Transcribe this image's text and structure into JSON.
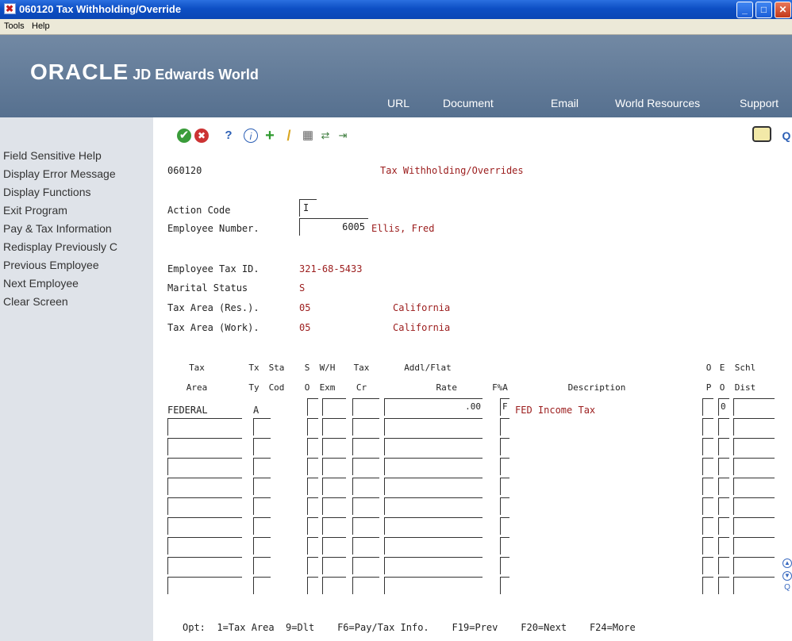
{
  "window": {
    "title": "060120   Tax Withholding/Override",
    "icon_glyph": "✖",
    "controls": {
      "minimize": "_",
      "maximize": "□",
      "close": "✕"
    }
  },
  "menubar": {
    "tools": "Tools",
    "help": "Help"
  },
  "banner": {
    "logo_oracle": "ORACLE",
    "logo_product": " JD Edwards World",
    "links": [
      "URL",
      "Document",
      "Email",
      "World Resources",
      "Support"
    ]
  },
  "sidebar": {
    "items": [
      "Field Sensitive Help",
      "Display Error Message",
      "Display Functions",
      "Exit Program",
      "Pay & Tax Information",
      "Redisplay Previously C",
      "Previous Employee",
      "Next Employee",
      "Clear Screen"
    ]
  },
  "toolbar": {
    "icons": [
      "ok-icon",
      "cancel-icon",
      "help-icon",
      "info-icon",
      "add-icon",
      "edit-icon",
      "delete-icon",
      "copy-icon",
      "export-icon"
    ],
    "glyphs": {
      "ok": "✔",
      "cancel": "✖",
      "help": "?",
      "info": "i",
      "add": "+",
      "edit": "/",
      "delete": "▦",
      "copy": "⇄",
      "export": "⇥",
      "chat": "▭",
      "search": "Q"
    }
  },
  "form": {
    "program_id": "060120",
    "title": "Tax Withholding/Overrides",
    "action_code_label": "Action Code",
    "action_code_value": "I",
    "employee_number_label": "Employee Number.",
    "employee_number_value": "6005",
    "employee_name": "Ellis, Fred",
    "tax_id_label": "Employee Tax ID.",
    "tax_id_value": "321-68-5433",
    "marital_label": "Marital Status",
    "marital_value": "S",
    "tax_area_res_label": "Tax Area (Res.).",
    "tax_area_res_code": "05",
    "tax_area_res_name": "California",
    "tax_area_work_label": "Tax Area (Work).",
    "tax_area_work_code": "05",
    "tax_area_work_name": "California"
  },
  "grid": {
    "headers": {
      "tax_area": [
        "Tax",
        "Area"
      ],
      "tx_ty": [
        "Tx",
        "Ty"
      ],
      "sta_cod": [
        "Sta",
        "Cod"
      ],
      "s_o": [
        "S",
        "O"
      ],
      "wh_exm": [
        "W/H",
        "Exm"
      ],
      "tax_cr": [
        "Tax",
        "Cr"
      ],
      "addl_rate": [
        "Addl/Flat",
        "Rate"
      ],
      "fa": [
        "",
        "F%A"
      ],
      "description": [
        "",
        "Description"
      ],
      "op": [
        "O",
        "P"
      ],
      "eo": [
        "E",
        "O"
      ],
      "schl_dist": [
        "Schl",
        "Dist"
      ]
    },
    "first_row": {
      "tax_area": "FEDERAL",
      "tx_ty": "A",
      "rate": ".00",
      "fa": "F",
      "description": "FED Income Tax",
      "eo": "0"
    }
  },
  "footer": {
    "options": "Opt:  1=Tax Area  9=Dlt    F6=Pay/Tax Info.    F19=Prev    F20=Next    F24=More"
  },
  "colors": {
    "banner": "#6a819d",
    "sidebar": "#dfe3e9",
    "titlebar": "#0d4fc4",
    "field_value": "#9b1c1c"
  }
}
